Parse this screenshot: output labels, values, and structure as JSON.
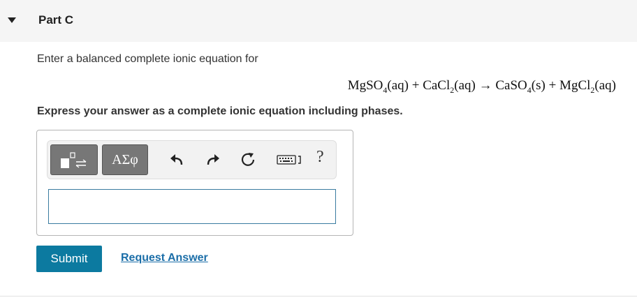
{
  "part": {
    "title": "Part C"
  },
  "question": {
    "prompt": "Enter a balanced complete ionic equation for",
    "equation": {
      "r1": "MgSO",
      "r1_sub": "4",
      "r1_phase": "(aq)",
      "plus1": "+",
      "r2": "CaCl",
      "r2_sub": "2",
      "r2_phase": "(aq)",
      "arrow": "→",
      "p1": "CaSO",
      "p1_sub": "4",
      "p1_phase": "(s)",
      "plus2": "+",
      "p2": "MgCl",
      "p2_sub": "2",
      "p2_phase": "(aq)"
    },
    "instruction": "Express your answer as a complete ionic equation including phases."
  },
  "toolbar": {
    "greek_label": "ΑΣφ",
    "help_label": "?",
    "icons": [
      "templates-icon",
      "undo-icon",
      "redo-icon",
      "reset-icon",
      "keyboard-icon",
      "help-icon"
    ]
  },
  "answer": {
    "value": ""
  },
  "actions": {
    "submit_label": "Submit",
    "request_label": "Request Answer"
  },
  "colors": {
    "submit_bg": "#0c7aa0",
    "link": "#1b6ea8",
    "toolbar_button": "#777777"
  }
}
